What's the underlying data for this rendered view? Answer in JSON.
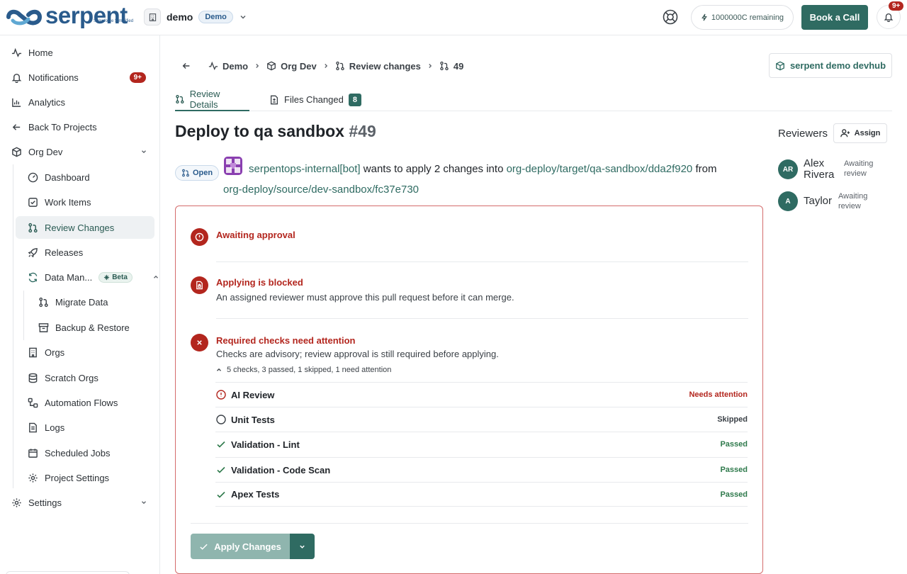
{
  "brand": {
    "name": "serpent",
    "tagline": "Salesforce Simplified"
  },
  "workspace": {
    "name": "demo",
    "badge": "Demo"
  },
  "header": {
    "credits": "1000000C remaining",
    "book_call": "Book a Call",
    "bell_badge": "9+"
  },
  "sidebar": {
    "home": "Home",
    "notifications": "Notifications",
    "notifications_badge": "9+",
    "analytics": "Analytics",
    "back": "Back To Projects",
    "org": "Org Dev",
    "items": {
      "dashboard": "Dashboard",
      "work_items": "Work Items",
      "review_changes": "Review Changes",
      "releases": "Releases",
      "data_management": "Data Man...",
      "beta": "Beta",
      "migrate": "Migrate Data",
      "backup": "Backup & Restore",
      "orgs": "Orgs",
      "scratch": "Scratch Orgs",
      "automation": "Automation Flows",
      "logs": "Logs",
      "scheduled": "Scheduled Jobs",
      "project_settings": "Project Settings"
    },
    "settings": "Settings"
  },
  "breadcrumb": {
    "demo": "Demo",
    "org": "Org Dev",
    "review": "Review changes",
    "id": "49"
  },
  "devhub": "serpent demo devhub",
  "tabs": {
    "details": "Review Details",
    "files": "Files Changed",
    "files_count": "8"
  },
  "pr": {
    "title": "Deploy to qa sandbox",
    "number": "#49",
    "status": "Open",
    "author": "serpentops-internal[bot]",
    "text_mid": " wants to apply 2 changes into ",
    "target": "org-deploy/target/qa-sandbox/dda2f920",
    "text_from": " from",
    "source": "org-deploy/source/dev-sandbox/fc37e730"
  },
  "reviewers": {
    "title": "Reviewers",
    "assign": "Assign",
    "list": [
      {
        "initials": "AR",
        "first": "Alex",
        "last": "Rivera",
        "status1": "Awaiting",
        "status2": "review"
      },
      {
        "initials": "A",
        "first": "Taylor",
        "last": "",
        "status1": "Awaiting",
        "status2": "review"
      }
    ]
  },
  "merge": {
    "awaiting": "Awaiting approval",
    "blocked_title": "Applying is blocked",
    "blocked_text": "An assigned reviewer must approve this pull request before it can merge.",
    "checks_title": "Required checks need attention",
    "checks_text": "Checks are advisory; review approval is still required before applying.",
    "checks_summary": "5 checks, 3 passed, 1 skipped, 1 need attention",
    "checks": [
      {
        "name": "AI Review",
        "state": "Needs attention",
        "kind": "warn"
      },
      {
        "name": "Unit Tests",
        "state": "Skipped",
        "kind": "skip"
      },
      {
        "name": "Validation - Lint",
        "state": "Passed",
        "kind": "pass"
      },
      {
        "name": "Validation - Code Scan",
        "state": "Passed",
        "kind": "pass"
      },
      {
        "name": "Apex Tests",
        "state": "Passed",
        "kind": "pass"
      }
    ],
    "apply": "Apply Changes"
  },
  "colors": {
    "accent": "#2f6b62",
    "danger": "#b3261e",
    "brand": "#2a5b8c"
  }
}
